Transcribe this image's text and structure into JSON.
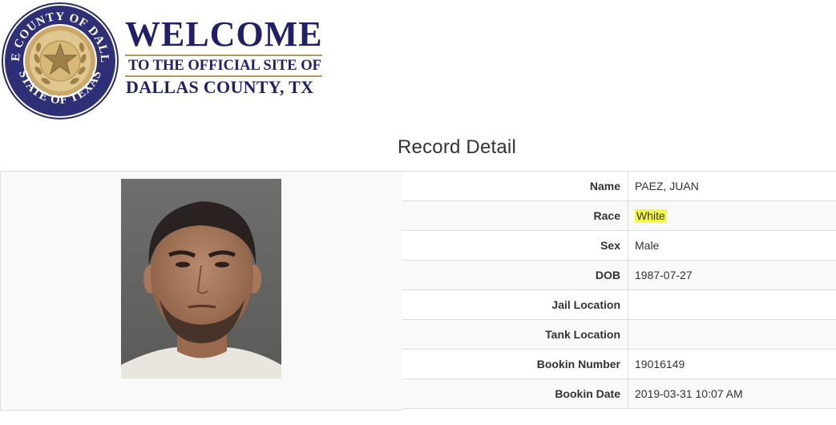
{
  "header": {
    "seal_text_top": "THE COUNTY OF DALLAS",
    "seal_text_bottom": "STATE OF TEXAS",
    "welcome": "WELCOME",
    "subtitle_line1": "TO THE OFFICIAL SITE OF",
    "subtitle_line2": "DALLAS COUNTY, TX"
  },
  "page_title": "Record Detail",
  "colors": {
    "navy": "#1f1f6b",
    "gold": "#b29a5b",
    "highlight": "#f5f742",
    "row_alt": "#f9f9f9",
    "border": "#dddddd"
  },
  "record": {
    "rows": [
      {
        "label": "Name",
        "value": "PAEZ, JUAN"
      },
      {
        "label": "Race",
        "value": "White"
      },
      {
        "label": "Sex",
        "value": "Male"
      },
      {
        "label": "DOB",
        "value": "1987-07-27"
      },
      {
        "label": "Jail Location",
        "value": ""
      },
      {
        "label": "Tank Location",
        "value": ""
      },
      {
        "label": "Bookin Number",
        "value": "19016149"
      },
      {
        "label": "Bookin Date",
        "value": "2019-03-31 10:07 AM"
      }
    ]
  },
  "icons": {
    "seal": "county-seal-icon",
    "star": "star-icon"
  }
}
